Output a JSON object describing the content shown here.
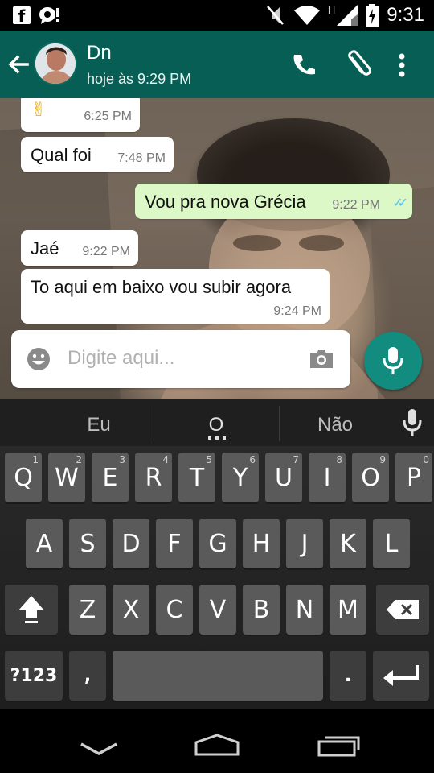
{
  "status_bar": {
    "time": "9:31",
    "network_label": "H"
  },
  "header": {
    "contact_name": "Dn",
    "contact_status": "hoje às 9:29 PM"
  },
  "messages": [
    {
      "direction": "in",
      "text": "✌",
      "time": "6:25 PM"
    },
    {
      "direction": "in",
      "text": "Qual foi",
      "time": "7:48 PM"
    },
    {
      "direction": "out",
      "text": "Vou pra nova Grécia",
      "time": "9:22 PM",
      "read_ticks": "✓✓"
    },
    {
      "direction": "in",
      "text": "Jaé",
      "time": "9:22 PM"
    },
    {
      "direction": "in",
      "text": "To aqui em baixo vou subir agora",
      "time": "9:24 PM"
    }
  ],
  "composer": {
    "placeholder": "Digite aqui..."
  },
  "keyboard": {
    "suggestions": [
      "Eu",
      "O",
      "Não"
    ],
    "row1": [
      "Q",
      "W",
      "E",
      "R",
      "T",
      "Y",
      "U",
      "I",
      "O",
      "P"
    ],
    "row1_hints": [
      "1",
      "2",
      "3",
      "4",
      "5",
      "6",
      "7",
      "8",
      "9",
      "0"
    ],
    "row2": [
      "A",
      "S",
      "D",
      "F",
      "G",
      "H",
      "J",
      "K",
      "L"
    ],
    "row3": [
      "Z",
      "X",
      "C",
      "V",
      "B",
      "N",
      "M"
    ],
    "symbols_key": "?123",
    "comma_key": ",",
    "period_key": "."
  },
  "colors": {
    "app_bar": "#075e54",
    "accent": "#128c7e",
    "outgoing_bubble": "#dcf8c6",
    "read_tick": "#4fc3f7"
  }
}
